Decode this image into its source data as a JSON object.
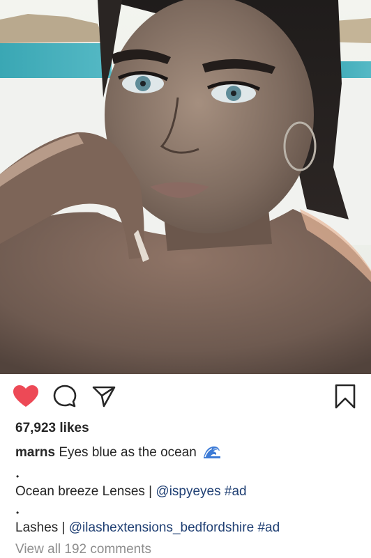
{
  "post": {
    "likes_text": "67,923 likes",
    "username": "marns",
    "caption_text": "Eyes blue as the ocean",
    "caption_emoji": "water-wave-emoji",
    "bullets": [
      "•",
      "•"
    ],
    "lines": [
      {
        "prefix": "Ocean breeze Lenses | ",
        "mention": "@ispyeyes",
        "hashtag": "#ad"
      },
      {
        "prefix": "Lashes | ",
        "mention": "@ilashextensions_bedfordshire",
        "hashtag": "#ad"
      }
    ],
    "view_comments_text": "View all 192 comments"
  },
  "actions": {
    "like_icon": "heart-icon",
    "comment_icon": "comment-icon",
    "share_icon": "paper-plane-icon",
    "save_icon": "bookmark-icon",
    "liked": true
  },
  "colors": {
    "like_red": "#ed4956",
    "text": "#262626",
    "link": "#1f3f73",
    "muted": "#8e8e8e"
  }
}
